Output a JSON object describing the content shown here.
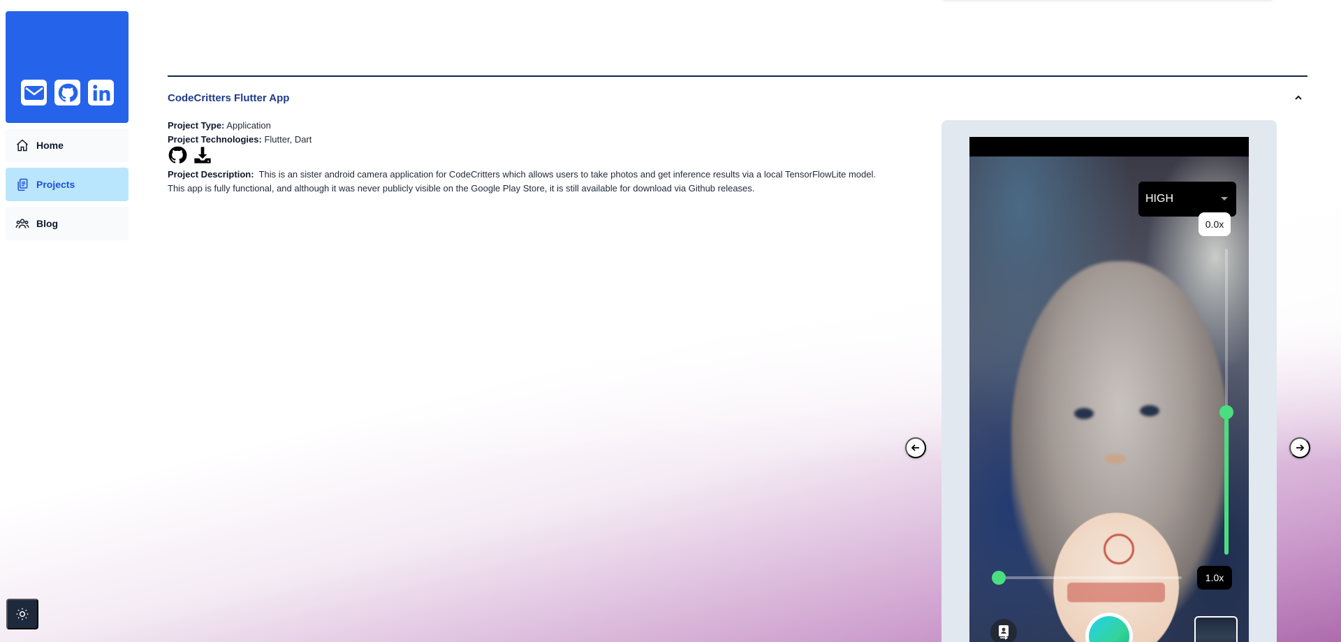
{
  "sidebar": {
    "social": {
      "icons": [
        "email-icon",
        "github-icon",
        "linkedin-icon"
      ],
      "accent": "#2563eb"
    },
    "items": [
      {
        "label": "Home",
        "icon": "home-icon",
        "active": false
      },
      {
        "label": "Projects",
        "icon": "documents-icon",
        "active": true
      },
      {
        "label": "Blog",
        "icon": "users-icon",
        "active": false
      }
    ]
  },
  "theme_toggle": {
    "icon": "sun-icon"
  },
  "project": {
    "title": "CodeCritters Flutter App",
    "type_label": "Project Type:",
    "type_value": "Application",
    "tech_label": "Project Technologies:",
    "tech_value": "Flutter, Dart",
    "link_icons": [
      "github-icon",
      "download-icon"
    ],
    "description_label": "Project Description:",
    "description_line1": "This is an sister android camera application for CodeCritters which allows users to take photos and get inference results via a local TensorFlowLite model.",
    "description_line2": "This app is fully functional, and although it was never publicly visible on the Google Play Store, it is still available for download via Github releases."
  },
  "screenshot": {
    "quality_value": "HIGH",
    "zoom_top": "0.0x",
    "zoom_bottom": "1.0x",
    "slider_accent": "#4ade80"
  },
  "carousel": {
    "prev_icon": "arrow-left-icon",
    "next_icon": "arrow-right-icon"
  }
}
